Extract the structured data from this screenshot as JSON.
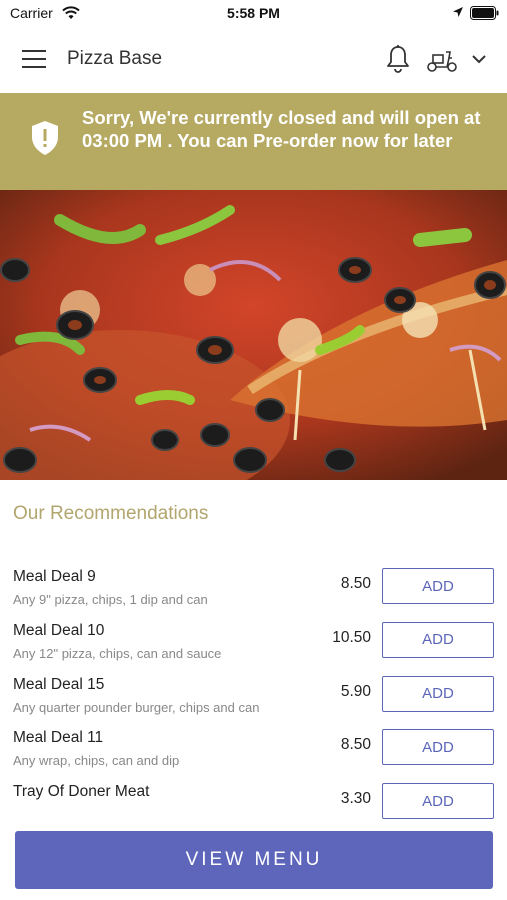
{
  "status_bar": {
    "carrier": "Carrier",
    "time": "5:58 PM"
  },
  "header": {
    "title": "Pizza Base",
    "icons": [
      "hamburger-menu-icon",
      "bell-icon",
      "scooter-icon",
      "chevron-down-icon"
    ]
  },
  "banner": {
    "message": "Sorry, We're currently closed and will open at 03:00 PM . You can Pre-order now for later",
    "icon": "shield-alert-icon",
    "background": "#b6a962"
  },
  "hero": {
    "image": "pizza-photo"
  },
  "recommendations": {
    "title": "Our Recommendations",
    "items": [
      {
        "name": "Meal Deal 9",
        "description": "Any 9\" pizza, chips, 1 dip and can",
        "price": "8.50",
        "action": "ADD"
      },
      {
        "name": "Meal Deal 10",
        "description": "Any 12\" pizza, chips, can and sauce",
        "price": "10.50",
        "action": "ADD"
      },
      {
        "name": "Meal Deal 15",
        "description": "Any quarter pounder burger, chips and can",
        "price": "5.90",
        "action": "ADD"
      },
      {
        "name": "Meal Deal 11",
        "description": "Any wrap, chips, can and dip",
        "price": "8.50",
        "action": "ADD"
      },
      {
        "name": "Tray Of Doner Meat",
        "description": "",
        "price": "3.30",
        "action": "ADD"
      }
    ]
  },
  "footer": {
    "view_menu_label": "VIEW MENU"
  },
  "colors": {
    "accent": "#5d66bb",
    "banner": "#b6a962",
    "section_title": "#b2a56d"
  }
}
